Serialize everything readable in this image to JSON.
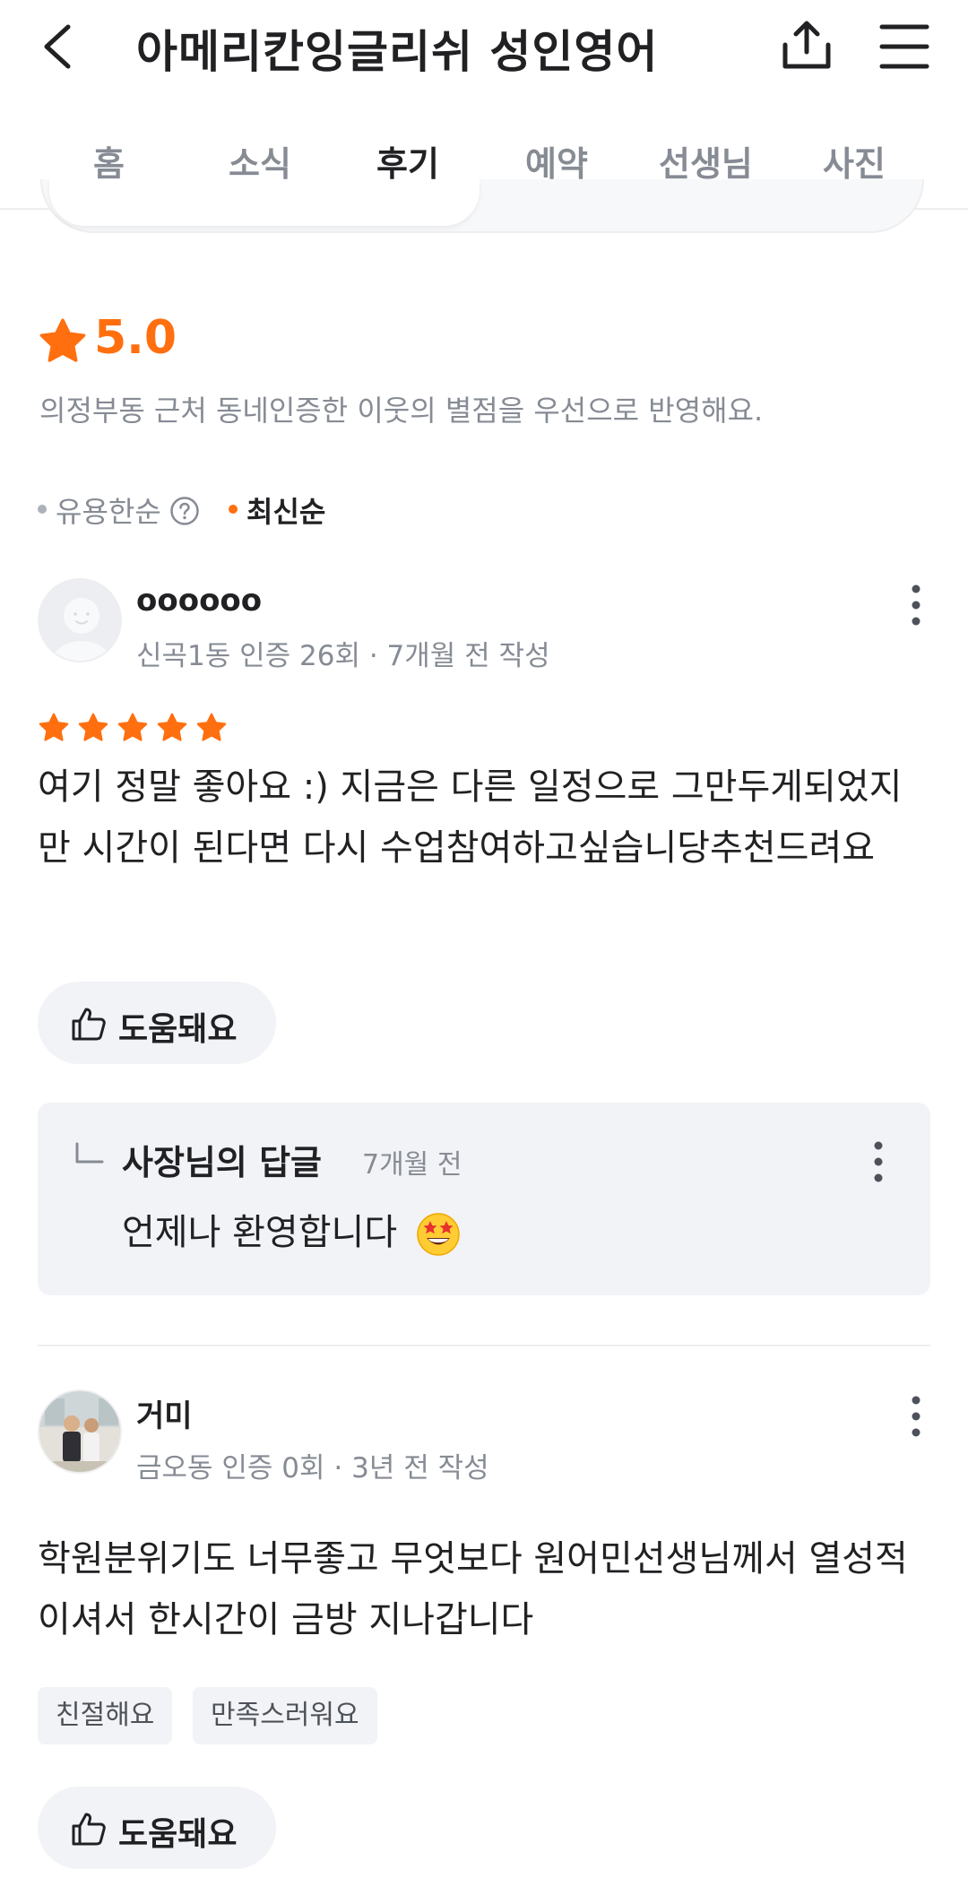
{
  "header": {
    "title": "아메리칸잉글리쉬 성인영어",
    "back_icon": "chevron-left-icon",
    "share_icon": "share-icon",
    "menu_icon": "hamburger-menu-icon"
  },
  "tabs": [
    {
      "label": "홈"
    },
    {
      "label": "소식"
    },
    {
      "label": "후기",
      "active": true
    },
    {
      "label": "예약"
    },
    {
      "label": "선생님"
    },
    {
      "label": "사진"
    }
  ],
  "rating": {
    "value": "5.0",
    "star_count": 5.0,
    "note": "의정부동 근처 동네인증한 이웃의 별점을 우선으로 반영해요."
  },
  "sort": {
    "options": [
      {
        "label": "유용한순",
        "selected": false
      },
      {
        "label": "최신순",
        "selected": true
      }
    ]
  },
  "reviews": [
    {
      "name": "oooooo",
      "meta": "신곡1동 인증 26회 · 7개월 전 작성",
      "stars": 5,
      "text": "여기 정말 좋아요 :) 지금은 다른 일정으로 그만두게되었지만 시간이 된다면 다시 수업참여하고싶습니당추천드려요",
      "helpful_label": "도움돼요",
      "reply": {
        "title": "사장님의 답글",
        "time": "7개월 전",
        "text": "언제나 환영합니다"
      }
    },
    {
      "name": "거미",
      "meta": "금오동 인증 0회 · 3년 전 작성",
      "text": "학원분위기도 너무좋고 무엇보다 원어민선생님께서 열성적이셔서 한시간이 금방 지나갑니다",
      "tags": [
        "친절해요",
        "만족스러워요"
      ],
      "helpful_label": "도움돼요"
    }
  ],
  "colors": {
    "accent": "#ff6f0f",
    "text": "#212124",
    "muted": "#868b94",
    "chip_bg": "#f2f3f6"
  }
}
